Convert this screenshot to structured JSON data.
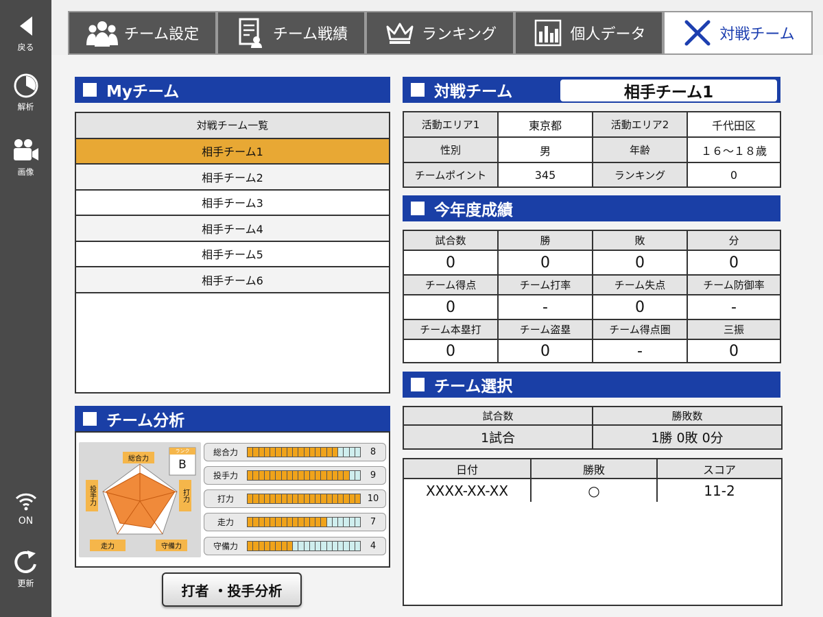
{
  "sidebar": {
    "back_label": "戻る",
    "analysis_label": "解析",
    "video_label": "画像",
    "wifi_label": "ON",
    "refresh_label": "更新"
  },
  "tabs": [
    {
      "label": "チーム設定",
      "icon": "team-icon"
    },
    {
      "label": "チーム戦績",
      "icon": "record-icon"
    },
    {
      "label": "ランキング",
      "icon": "crown-icon"
    },
    {
      "label": "個人データ",
      "icon": "bar-chart-icon"
    },
    {
      "label": "対戦チーム",
      "icon": "crossed-bats-icon",
      "active": true
    }
  ],
  "my_team": {
    "title": "Myチーム",
    "list_header": "対戦チーム一覧",
    "teams": [
      "相手チーム1",
      "相手チーム2",
      "相手チーム3",
      "相手チーム4",
      "相手チーム5",
      "相手チーム6"
    ],
    "selected_index": 0
  },
  "opponent": {
    "title": "対戦チーム",
    "name": "相手チーム1",
    "info": {
      "area1_label": "活動エリア1",
      "area1_value": "東京都",
      "area2_label": "活動エリア2",
      "area2_value": "千代田区",
      "gender_label": "性別",
      "gender_value": "男",
      "age_label": "年齢",
      "age_value": "１６～１８歳",
      "points_label": "チームポイント",
      "points_value": "345",
      "ranking_label": "ランキング",
      "ranking_value": "0"
    }
  },
  "season": {
    "title": "今年度成績",
    "rows": [
      {
        "labels": [
          "試合数",
          "勝",
          "敗",
          "分"
        ],
        "values": [
          "0",
          "0",
          "0",
          "0"
        ]
      },
      {
        "labels": [
          "チーム得点",
          "チーム打率",
          "チーム失点",
          "チーム防御率"
        ],
        "values": [
          "0",
          "-",
          "0",
          "-"
        ]
      },
      {
        "labels": [
          "チーム本塁打",
          "チーム盗塁",
          "チーム得点圏",
          "三振"
        ],
        "values": [
          "0",
          "0",
          "-",
          "0"
        ]
      }
    ]
  },
  "selection": {
    "title": "チーム選択",
    "games_label": "試合数",
    "record_label": "勝敗数",
    "games_value": "1試合",
    "record_value": "1勝 0敗 0分",
    "history_headers": [
      "日付",
      "勝敗",
      "スコア"
    ],
    "history": [
      {
        "date": "XXXX-XX-XX",
        "result": "○",
        "score": "11-2"
      }
    ]
  },
  "analysis": {
    "title": "チーム分析",
    "radar_labels": {
      "top": "総合力",
      "right": "打力",
      "bottom_right": "守備力",
      "bottom_left": "走力",
      "left": "投手力"
    },
    "rank_label": "ランク",
    "grade": "B",
    "stats": [
      {
        "name": "総合力",
        "value": 8,
        "max": 10
      },
      {
        "name": "投手力",
        "value": 9,
        "max": 10
      },
      {
        "name": "打力",
        "value": 10,
        "max": 10
      },
      {
        "name": "走力",
        "value": 7,
        "max": 10
      },
      {
        "name": "守備力",
        "value": 4,
        "max": 10
      }
    ],
    "button_label": "打者 ・投手分析"
  },
  "colors": {
    "accent_blue": "#1a3fa6",
    "selected_row": "#e8a834",
    "bar_on": "#f0a31a",
    "bar_off": "#cfeeee",
    "radar_fill": "#f08a3a"
  }
}
